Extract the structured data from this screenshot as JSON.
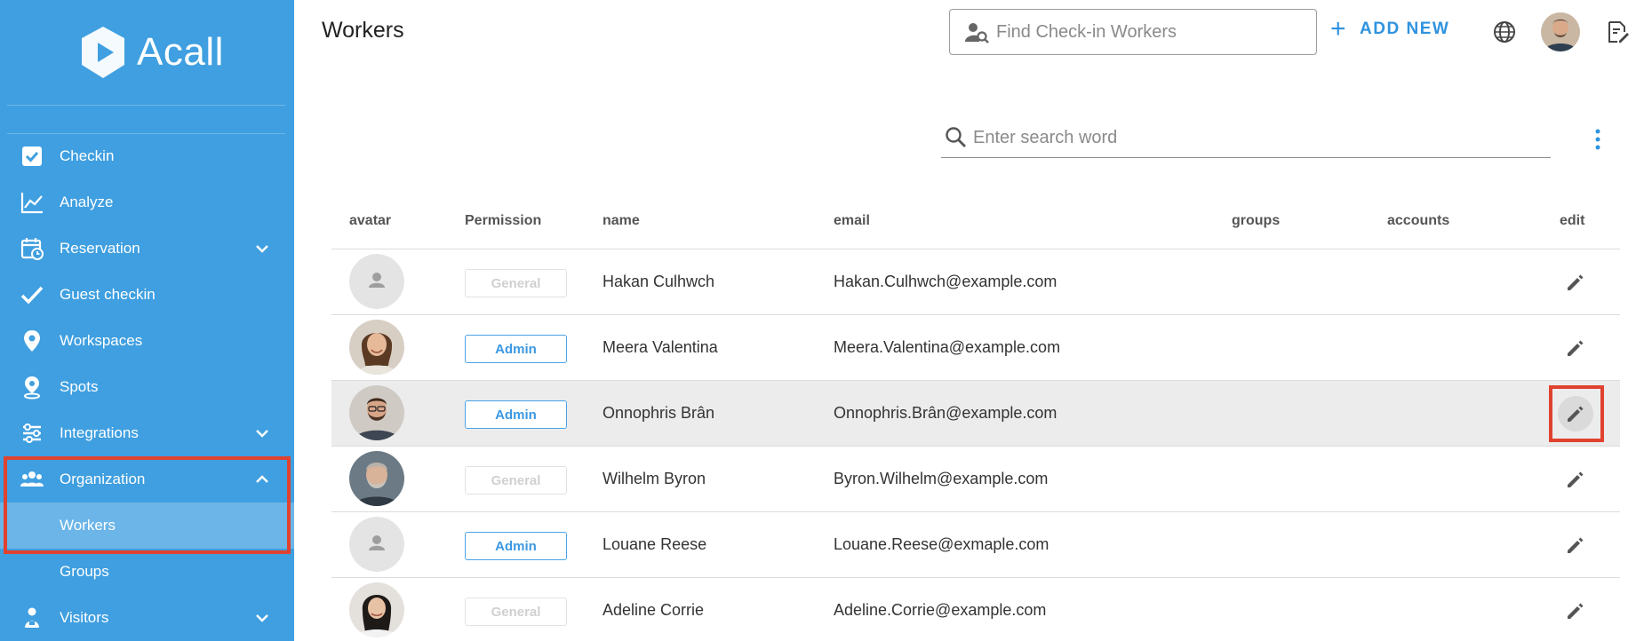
{
  "app": {
    "logo_text": "Acall"
  },
  "colors": {
    "sidebar": "#3f9fe0",
    "accent": "#2f93e0",
    "highlight": "#e0422f",
    "sub_active": "#6bb5e8"
  },
  "sidebar": {
    "items": [
      {
        "label": "Checkin",
        "icon": "checkbox-icon",
        "chevron": false
      },
      {
        "label": "Analyze",
        "icon": "chart-line-icon",
        "chevron": false
      },
      {
        "label": "Reservation",
        "icon": "calendar-clock-icon",
        "chevron": "down"
      },
      {
        "label": "Guest checkin",
        "icon": "check-icon",
        "chevron": false
      },
      {
        "label": "Workspaces",
        "icon": "map-pin-icon",
        "chevron": false
      },
      {
        "label": "Spots",
        "icon": "spot-pin-icon",
        "chevron": false
      },
      {
        "label": "Integrations",
        "icon": "integrations-icon",
        "chevron": "down"
      },
      {
        "label": "Organization",
        "icon": "people-icon",
        "chevron": "up"
      },
      {
        "label": "Visitors",
        "icon": "visitor-icon",
        "chevron": "down"
      }
    ],
    "sub_items": [
      {
        "label": "Workers",
        "active": true
      },
      {
        "label": "Groups",
        "active": false
      }
    ]
  },
  "header": {
    "title": "Workers",
    "find_placeholder": "Find Check-in Workers",
    "add_new_label": "ADD NEW"
  },
  "search": {
    "placeholder": "Enter search word"
  },
  "table": {
    "columns": [
      "avatar",
      "Permission",
      "name",
      "email",
      "groups",
      "accounts",
      "edit"
    ],
    "rows": [
      {
        "avatar": "placeholder",
        "permission": "General",
        "name": "Hakan Culhwch",
        "email": "Hakan.Culhwch@example.com"
      },
      {
        "avatar": "photo-woman-1",
        "permission": "Admin",
        "name": "Meera Valentina",
        "email": "Meera.Valentina@example.com"
      },
      {
        "avatar": "photo-man-1",
        "permission": "Admin",
        "name": "Onnophris Brân",
        "email": "Onnophris.Brân@example.com"
      },
      {
        "avatar": "photo-man-2",
        "permission": "General",
        "name": "Wilhelm Byron",
        "email": "Byron.Wilhelm@example.com"
      },
      {
        "avatar": "placeholder",
        "permission": "Admin",
        "name": "Louane Reese",
        "email": "Louane.Reese@exmaple.com"
      },
      {
        "avatar": "photo-woman-2",
        "permission": "General",
        "name": "Adeline Corrie",
        "email": "Adeline.Corrie@example.com"
      }
    ]
  }
}
